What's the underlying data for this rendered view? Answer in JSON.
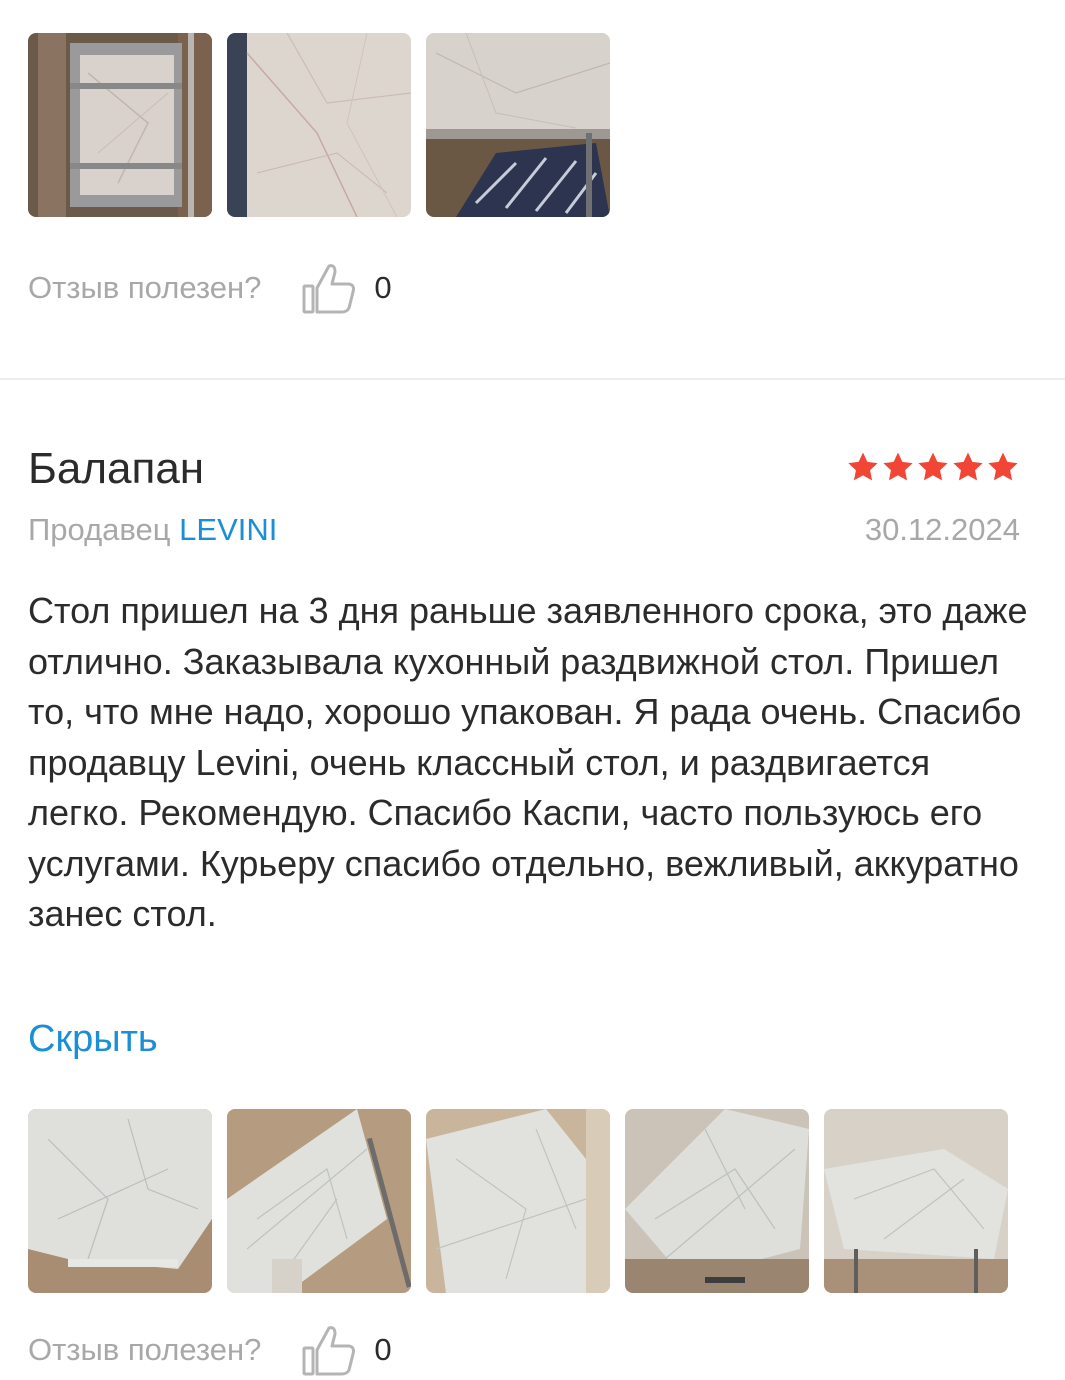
{
  "prev_review": {
    "photos": [
      {
        "name": "photo-table-packed"
      },
      {
        "name": "photo-marble-top-closeup"
      },
      {
        "name": "photo-table-on-rug"
      }
    ],
    "helpful_label": "Отзыв полезен?",
    "helpful_count": "0",
    "thumb_icon": "thumbs-up-icon"
  },
  "review": {
    "author": "Балапан",
    "rating": 5,
    "star_color": "#f14635",
    "seller_prefix": "Продавец",
    "seller_name": "LEVINI",
    "date": "30.12.2024",
    "text": "Стол пришел на 3 дня раньше заявленного срока, это даже отлично. Заказывала кухонный раздвижной стол. Пришел то, что мне надо, хорошо упакован. Я рада очень. Спасибо продавцу Levini, очень классный стол, и раздвигается легко. Рекомендую. Спасибо Каспи, часто пользуюсь его услугами. Курьеру спасибо отдельно, вежливый, аккуратно занес стол.",
    "hide_label": "Скрыть",
    "photos": [
      {
        "name": "photo-table-top-1"
      },
      {
        "name": "photo-table-side-2"
      },
      {
        "name": "photo-table-angle-3"
      },
      {
        "name": "photo-table-angle-4"
      },
      {
        "name": "photo-table-full-5"
      }
    ],
    "helpful_label": "Отзыв полезен?",
    "helpful_count": "0"
  },
  "colors": {
    "link": "#1a8fd6",
    "muted": "#a8a8a8",
    "text": "#2b2b2b"
  }
}
